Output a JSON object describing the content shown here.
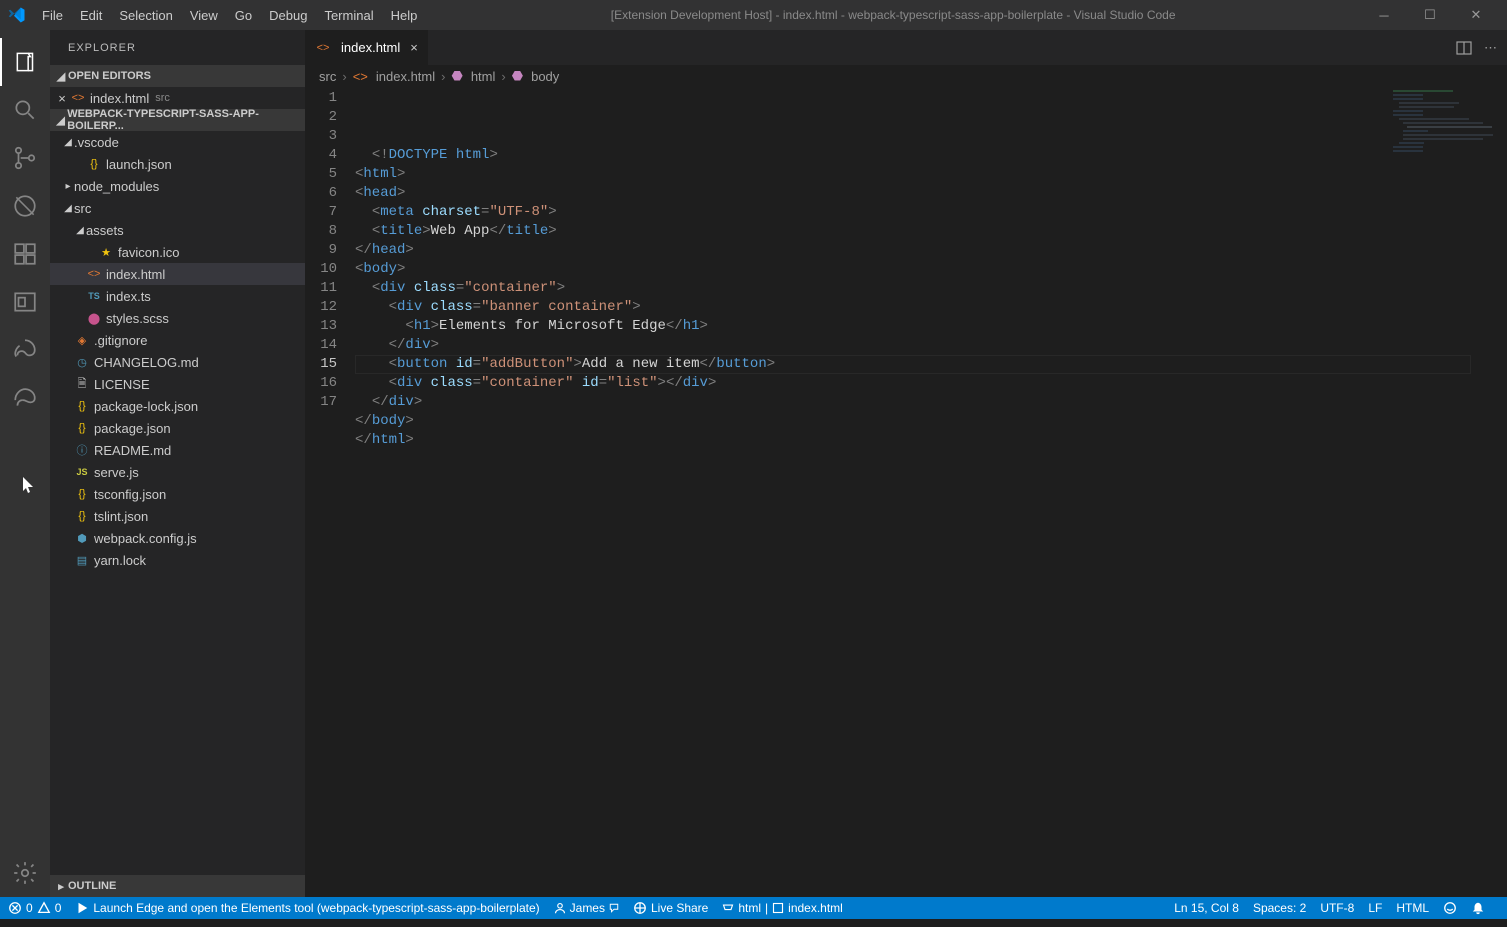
{
  "menu": [
    "File",
    "Edit",
    "Selection",
    "View",
    "Go",
    "Debug",
    "Terminal",
    "Help"
  ],
  "title": "[Extension Development Host] - index.html - webpack-typescript-sass-app-boilerplate - Visual Studio Code",
  "sidebar": {
    "title": "EXPLORER",
    "sections": {
      "open_editors": "OPEN EDITORS",
      "project": "WEBPACK-TYPESCRIPT-SASS-APP-BOILERP...",
      "outline": "OUTLINE"
    },
    "open_editor_file": "index.html",
    "open_editor_dir": "src",
    "tree": [
      {
        "name": ".vscode",
        "type": "folder",
        "expanded": true,
        "indent": 1
      },
      {
        "name": "launch.json",
        "type": "json",
        "indent": 2
      },
      {
        "name": "node_modules",
        "type": "folder",
        "expanded": false,
        "indent": 1
      },
      {
        "name": "src",
        "type": "folder",
        "expanded": true,
        "indent": 1
      },
      {
        "name": "assets",
        "type": "folder",
        "expanded": true,
        "indent": 2
      },
      {
        "name": "favicon.ico",
        "type": "star",
        "indent": 3
      },
      {
        "name": "index.html",
        "type": "html",
        "indent": 2,
        "active": true
      },
      {
        "name": "index.ts",
        "type": "ts",
        "indent": 2
      },
      {
        "name": "styles.scss",
        "type": "scss",
        "indent": 2
      },
      {
        "name": ".gitignore",
        "type": "git",
        "indent": 1
      },
      {
        "name": "CHANGELOG.md",
        "type": "clock",
        "indent": 1
      },
      {
        "name": "LICENSE",
        "type": "lic",
        "indent": 1
      },
      {
        "name": "package-lock.json",
        "type": "json",
        "indent": 1
      },
      {
        "name": "package.json",
        "type": "json",
        "indent": 1
      },
      {
        "name": "README.md",
        "type": "info",
        "indent": 1
      },
      {
        "name": "serve.js",
        "type": "js",
        "indent": 1
      },
      {
        "name": "tsconfig.json",
        "type": "json",
        "indent": 1
      },
      {
        "name": "tslint.json",
        "type": "json",
        "indent": 1
      },
      {
        "name": "webpack.config.js",
        "type": "webpack",
        "indent": 1
      },
      {
        "name": "yarn.lock",
        "type": "lock",
        "indent": 1
      }
    ]
  },
  "tab": {
    "label": "index.html"
  },
  "breadcrumb": [
    "src",
    "index.html",
    "html",
    "body"
  ],
  "code_lines": [
    "  <!DOCTYPE html>",
    "<html>",
    "<head>",
    "  <meta charset=\"UTF-8\">",
    "  <title>Web App</title>",
    "</head>",
    "<body>",
    "  <div class=\"container\">",
    "    <div class=\"banner container\">",
    "      <h1>Elements for Microsoft Edge</h1>",
    "    </div>",
    "    <button id=\"addButton\">Add a new item</button>",
    "    <div class=\"container\" id=\"list\"></div>",
    "  </div>",
    "</body>",
    "</html>",
    ""
  ],
  "status": {
    "errors": "0",
    "warnings": "0",
    "launch": "Launch Edge and open the Elements tool (webpack-typescript-sass-app-boilerplate)",
    "user": "James",
    "liveshare": "Live Share",
    "lang_tag": "html",
    "file_tag": "index.html",
    "ln_col": "Ln 15, Col 8",
    "spaces": "Spaces: 2",
    "encoding": "UTF-8",
    "eol": "LF",
    "lang": "HTML"
  }
}
